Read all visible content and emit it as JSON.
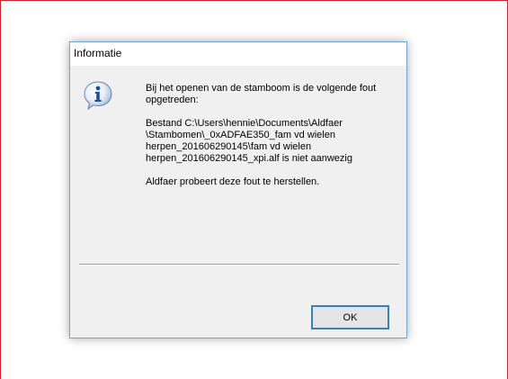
{
  "dialog": {
    "title": "Informatie",
    "icon": "information-icon",
    "message": {
      "line1": "Bij het openen van de stamboom is de volgende fout",
      "line2": "opgetreden:",
      "line3": "Bestand C:\\Users\\hennie\\Documents\\Aldfaer",
      "line4": "\\Stambomen\\_0xADFAE350_fam vd wielen",
      "line5": "herpen_201606290145\\fam vd wielen",
      "line6": "herpen_201606290145_xpi.alf is niet aanwezig",
      "line7": "Aldfaer probeert deze fout te herstellen."
    },
    "ok_label": "OK"
  },
  "colors": {
    "dialog_border": "#6fa5d8",
    "dialog_background": "#f0f0f0",
    "button_border": "#3c7fb1",
    "outer_frame": "#c8232b"
  }
}
